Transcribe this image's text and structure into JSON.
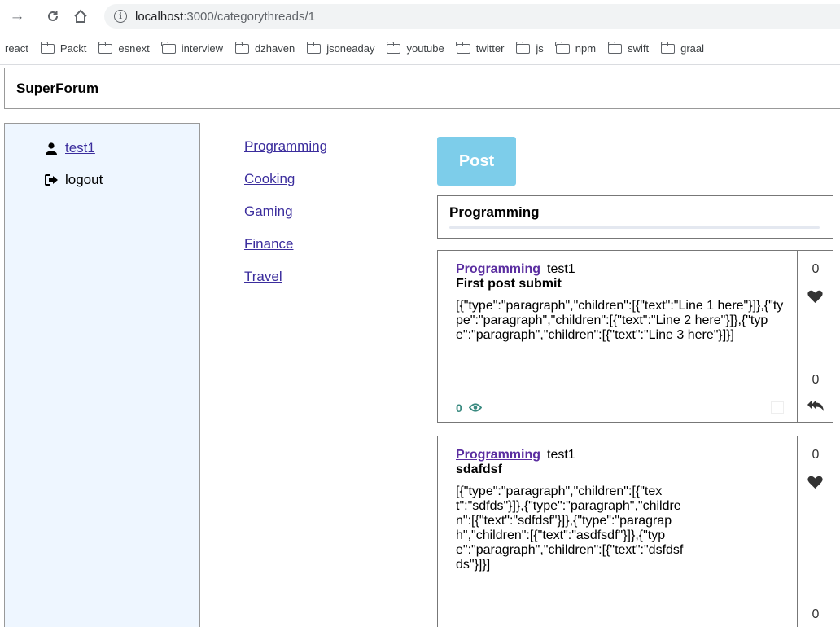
{
  "browser": {
    "url_host": "localhost",
    "url_path": ":3000/categorythreads/1",
    "bookmarks": [
      {
        "label": "react",
        "folder": false
      },
      {
        "label": "Packt",
        "folder": true
      },
      {
        "label": "esnext",
        "folder": true
      },
      {
        "label": "interview",
        "folder": true
      },
      {
        "label": "dzhaven",
        "folder": true
      },
      {
        "label": "jsoneaday",
        "folder": true
      },
      {
        "label": "youtube",
        "folder": true
      },
      {
        "label": "twitter",
        "folder": true
      },
      {
        "label": "js",
        "folder": true
      },
      {
        "label": "npm",
        "folder": true
      },
      {
        "label": "swift",
        "folder": true
      },
      {
        "label": "graal",
        "folder": true
      }
    ]
  },
  "app": {
    "title": "SuperForum"
  },
  "sidebar": {
    "username": "test1",
    "logout_label": "logout"
  },
  "categories": [
    "Programming",
    "Cooking",
    "Gaming",
    "Finance",
    "Travel"
  ],
  "main": {
    "post_button": "Post",
    "category_title": "Programming"
  },
  "threads": [
    {
      "category": "Programming",
      "user": "test1",
      "title": "First post submit",
      "body": "[{\"type\":\"paragraph\",\"children\":[{\"text\":\"Line 1 here\"}]},{\"type\":\"paragraph\",\"children\":[{\"text\":\"Line 2 here\"}]},{\"type\":\"paragraph\",\"children\":[{\"text\":\"Line 3 here\"}]}]",
      "views": "0",
      "likes": "0",
      "replies": "0"
    },
    {
      "category": "Programming",
      "user": "test1",
      "title": "sdafdsf",
      "body": "[{\"type\":\"paragraph\",\"children\":[{\"text\":\"sdfds\"}]},{\"type\":\"paragraph\",\"children\":[{\"text\":\"sdfdsf\"}]},{\"type\":\"paragraph\",\"children\":[{\"text\":\"asdfsdf\"}]},{\"type\":\"paragraph\",\"children\":[{\"text\":\"dsfdsfds\"}]}]",
      "likes": "0",
      "replies": "0"
    }
  ],
  "colors": {
    "link": "#3b2d9d",
    "post_button": "#7dcdea",
    "sidebar_bg": "#eef6ff",
    "views": "#3a8a80"
  }
}
